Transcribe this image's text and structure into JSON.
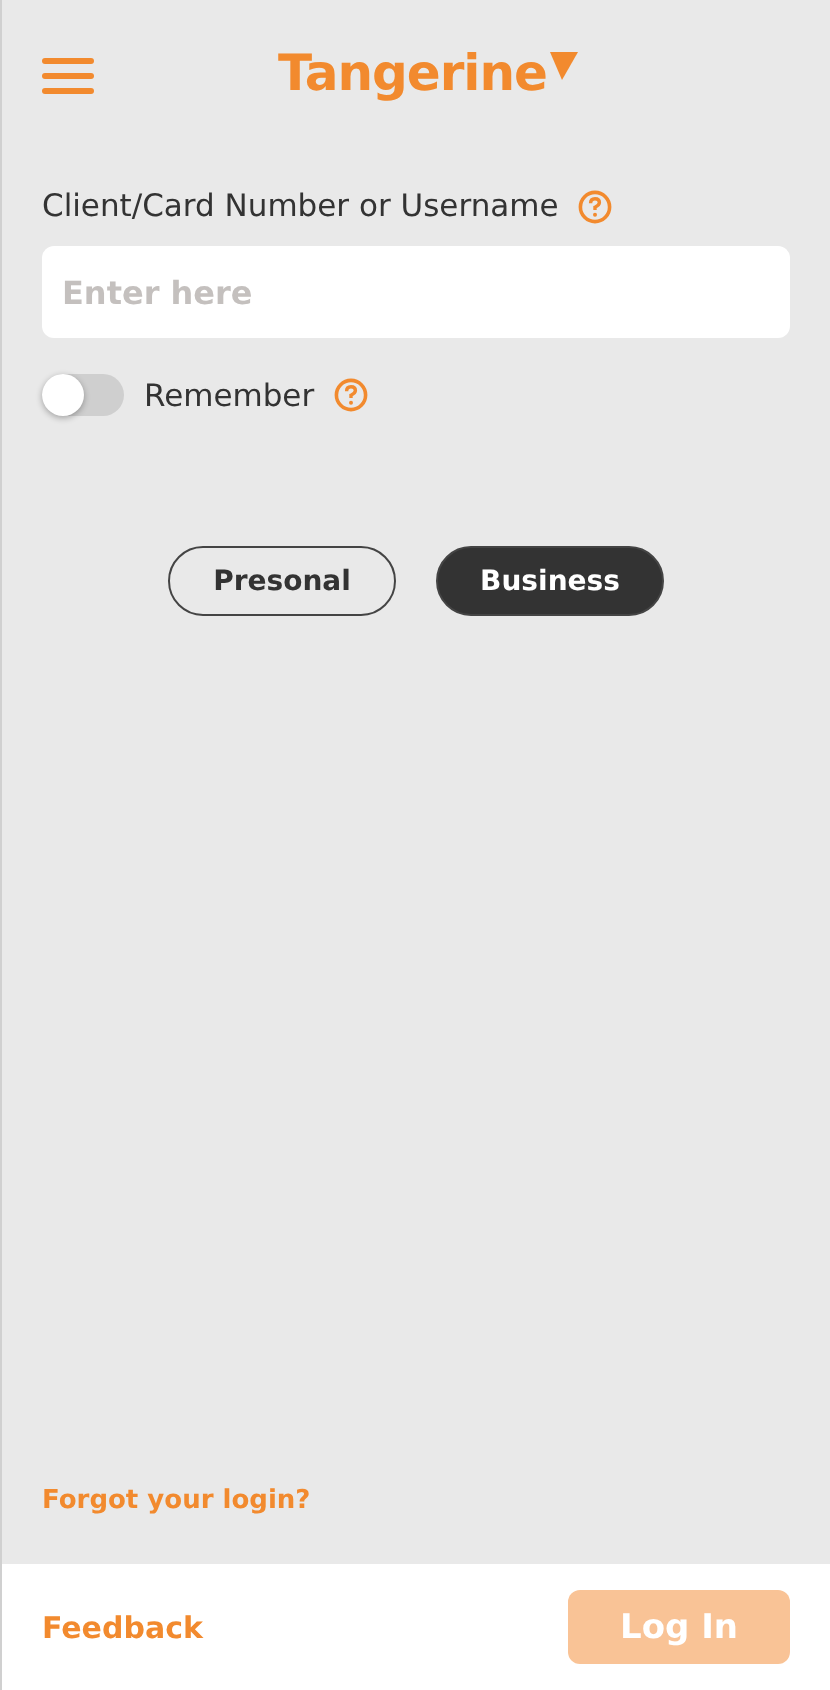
{
  "header": {
    "logo": "Tangerine"
  },
  "login_field": {
    "label": "Client/Card Number or Username",
    "placeholder": "Enter here"
  },
  "remember": {
    "label": "Remember",
    "on": false
  },
  "account_types": [
    {
      "label": "Presonal",
      "selected": false
    },
    {
      "label": "Business",
      "selected": true
    }
  ],
  "forgot_link": "Forgot your login?",
  "footer": {
    "feedback": "Feedback",
    "login_button": {
      "label": "Log In",
      "disabled": true
    }
  }
}
